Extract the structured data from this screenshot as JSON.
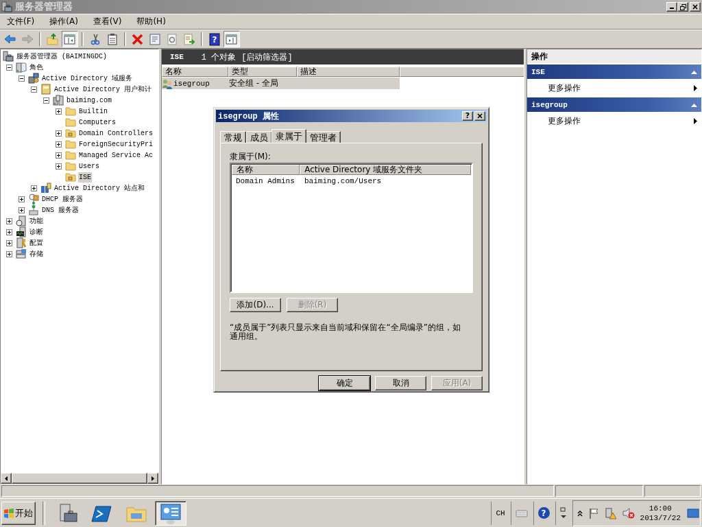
{
  "window": {
    "title": "服务器管理器"
  },
  "menu": [
    "文件(F)",
    "操作(A)",
    "查看(V)",
    "帮助(H)"
  ],
  "toolbar": [
    {
      "kind": "back",
      "disabled": false,
      "pressed": false
    },
    {
      "kind": "forward",
      "disabled": true,
      "pressed": false
    },
    {
      "kind": "separator"
    },
    {
      "kind": "up",
      "disabled": false,
      "pressed": false
    },
    {
      "kind": "console-tree",
      "disabled": false,
      "pressed": true
    },
    {
      "kind": "separator"
    },
    {
      "kind": "cut",
      "disabled": false,
      "pressed": false
    },
    {
      "kind": "paste",
      "disabled": false,
      "pressed": false
    },
    {
      "kind": "separator"
    },
    {
      "kind": "delete",
      "disabled": false,
      "pressed": false
    },
    {
      "kind": "properties",
      "disabled": false,
      "pressed": false
    },
    {
      "kind": "refresh",
      "disabled": false,
      "pressed": false
    },
    {
      "kind": "export",
      "disabled": false,
      "pressed": false
    },
    {
      "kind": "separator"
    },
    {
      "kind": "help",
      "label": "?",
      "disabled": false,
      "pressed": false
    },
    {
      "kind": "action-pane",
      "disabled": false,
      "pressed": true
    }
  ],
  "tree": [
    {
      "label": "服务器管理器 (BAIMINGDC)",
      "kind": "server",
      "selected": false,
      "children": [
        {
          "label": "角色",
          "kind": "roles",
          "expanded": true,
          "selected": false,
          "children": [
            {
              "label": "Active Directory 域服务",
              "kind": "adds",
              "expanded": true,
              "selected": false,
              "children": [
                {
                  "label": "Active Directory 用户和计",
                  "kind": "book",
                  "expanded": true,
                  "selected": false,
                  "children": [
                    {
                      "label": "baiming.com",
                      "kind": "domain",
                      "expanded": true,
                      "selected": false,
                      "children": [
                        {
                          "label": "Builtin",
                          "kind": "folder",
                          "expanded": false,
                          "selected": false
                        },
                        {
                          "label": "Computers",
                          "kind": "folder",
                          "selected": false
                        },
                        {
                          "label": "Domain Controllers",
                          "kind": "ou",
                          "expanded": false,
                          "selected": false
                        },
                        {
                          "label": "ForeignSecurityPri",
                          "kind": "folder",
                          "expanded": false,
                          "selected": false
                        },
                        {
                          "label": "Managed Service Ac",
                          "kind": "folder",
                          "expanded": false,
                          "selected": false
                        },
                        {
                          "label": "Users",
                          "kind": "folder",
                          "expanded": false,
                          "selected": false
                        },
                        {
                          "label": "ISE",
                          "kind": "ou",
                          "selected": true
                        }
                      ]
                    }
                  ]
                },
                {
                  "label": "Active Directory 站点和",
                  "kind": "sites",
                  "expanded": false,
                  "selected": false
                }
              ]
            },
            {
              "label": "DHCP 服务器",
              "kind": "dhcp",
              "expanded": false,
              "selected": false
            },
            {
              "label": "DNS 服务器",
              "kind": "dns",
              "expanded": false,
              "selected": false
            }
          ]
        },
        {
          "label": "功能",
          "kind": "features",
          "expanded": false,
          "selected": false
        },
        {
          "label": "诊断",
          "kind": "diagnostics",
          "expanded": false,
          "selected": false
        },
        {
          "label": "配置",
          "kind": "config",
          "expanded": false,
          "selected": false
        },
        {
          "label": "存储",
          "kind": "storage",
          "expanded": false,
          "selected": false
        }
      ]
    }
  ],
  "result": {
    "title": "ISE",
    "count": "1 个对象",
    "filter": "[启动筛选器]",
    "columns": [
      "名称",
      "类型",
      "描述"
    ],
    "rows": [
      {
        "name": "isegroup",
        "type": "安全组 - 全局",
        "selected": true
      }
    ]
  },
  "actions": {
    "title": "操作",
    "sections": [
      {
        "title": "ISE",
        "expanded": true,
        "items": [
          "更多操作"
        ]
      },
      {
        "title": "isegroup",
        "expanded": true,
        "items": [
          "更多操作"
        ]
      }
    ]
  },
  "dialog": {
    "title": "isegroup 属性",
    "help_button": "?",
    "tabs": [
      {
        "label": "常规",
        "selected": false
      },
      {
        "label": "成员",
        "selected": false
      },
      {
        "label": "隶属于",
        "selected": true
      },
      {
        "label": "管理者",
        "selected": false
      }
    ],
    "list_label": "隶属于(M):",
    "columns": [
      "名称",
      "Active Directory 域服务文件夹"
    ],
    "rows": [
      {
        "name": "Domain Admins",
        "folder": "baiming.com/Users"
      }
    ],
    "list_buttons": [
      {
        "label": "添加(D)...",
        "disabled": false
      },
      {
        "label": "删除(R)",
        "disabled": true
      }
    ],
    "note": "“成员属于”列表只显示来自当前域和保留在“全局编录”的组，如通用组。",
    "buttons": [
      {
        "label": "确定",
        "disabled": false,
        "default": true
      },
      {
        "label": "取消",
        "disabled": false,
        "default": false
      },
      {
        "label": "应用(A)",
        "disabled": true,
        "default": false
      }
    ]
  },
  "taskbar": {
    "start": "开始",
    "apps": [
      {
        "kind": "server",
        "selected": false
      },
      {
        "kind": "powershell",
        "selected": false
      },
      {
        "kind": "explorer",
        "selected": false
      },
      {
        "kind": "panel",
        "selected": true
      }
    ],
    "language": "CH",
    "help": "?",
    "time": "16:00",
    "date": "2013/7/22"
  }
}
